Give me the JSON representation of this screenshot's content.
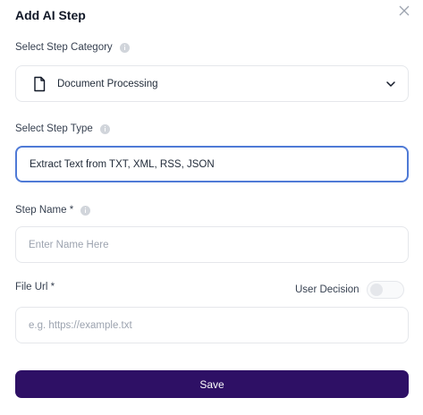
{
  "dialog": {
    "title": "Add AI Step"
  },
  "step_category": {
    "label": "Select Step Category",
    "value": "Document Processing"
  },
  "step_type": {
    "label": "Select Step Type",
    "value": "Extract Text from TXT, XML, RSS, JSON"
  },
  "step_name": {
    "label": "Step Name *",
    "placeholder": "Enter Name Here",
    "value": ""
  },
  "file_url": {
    "label": "File Url *",
    "placeholder": "e.g. https://example.txt",
    "value": ""
  },
  "user_decision": {
    "label": "User Decision",
    "enabled": false
  },
  "save_button": {
    "label": "Save"
  },
  "colors": {
    "primary": "#2e1065",
    "focus_border": "#4f7ad6"
  }
}
